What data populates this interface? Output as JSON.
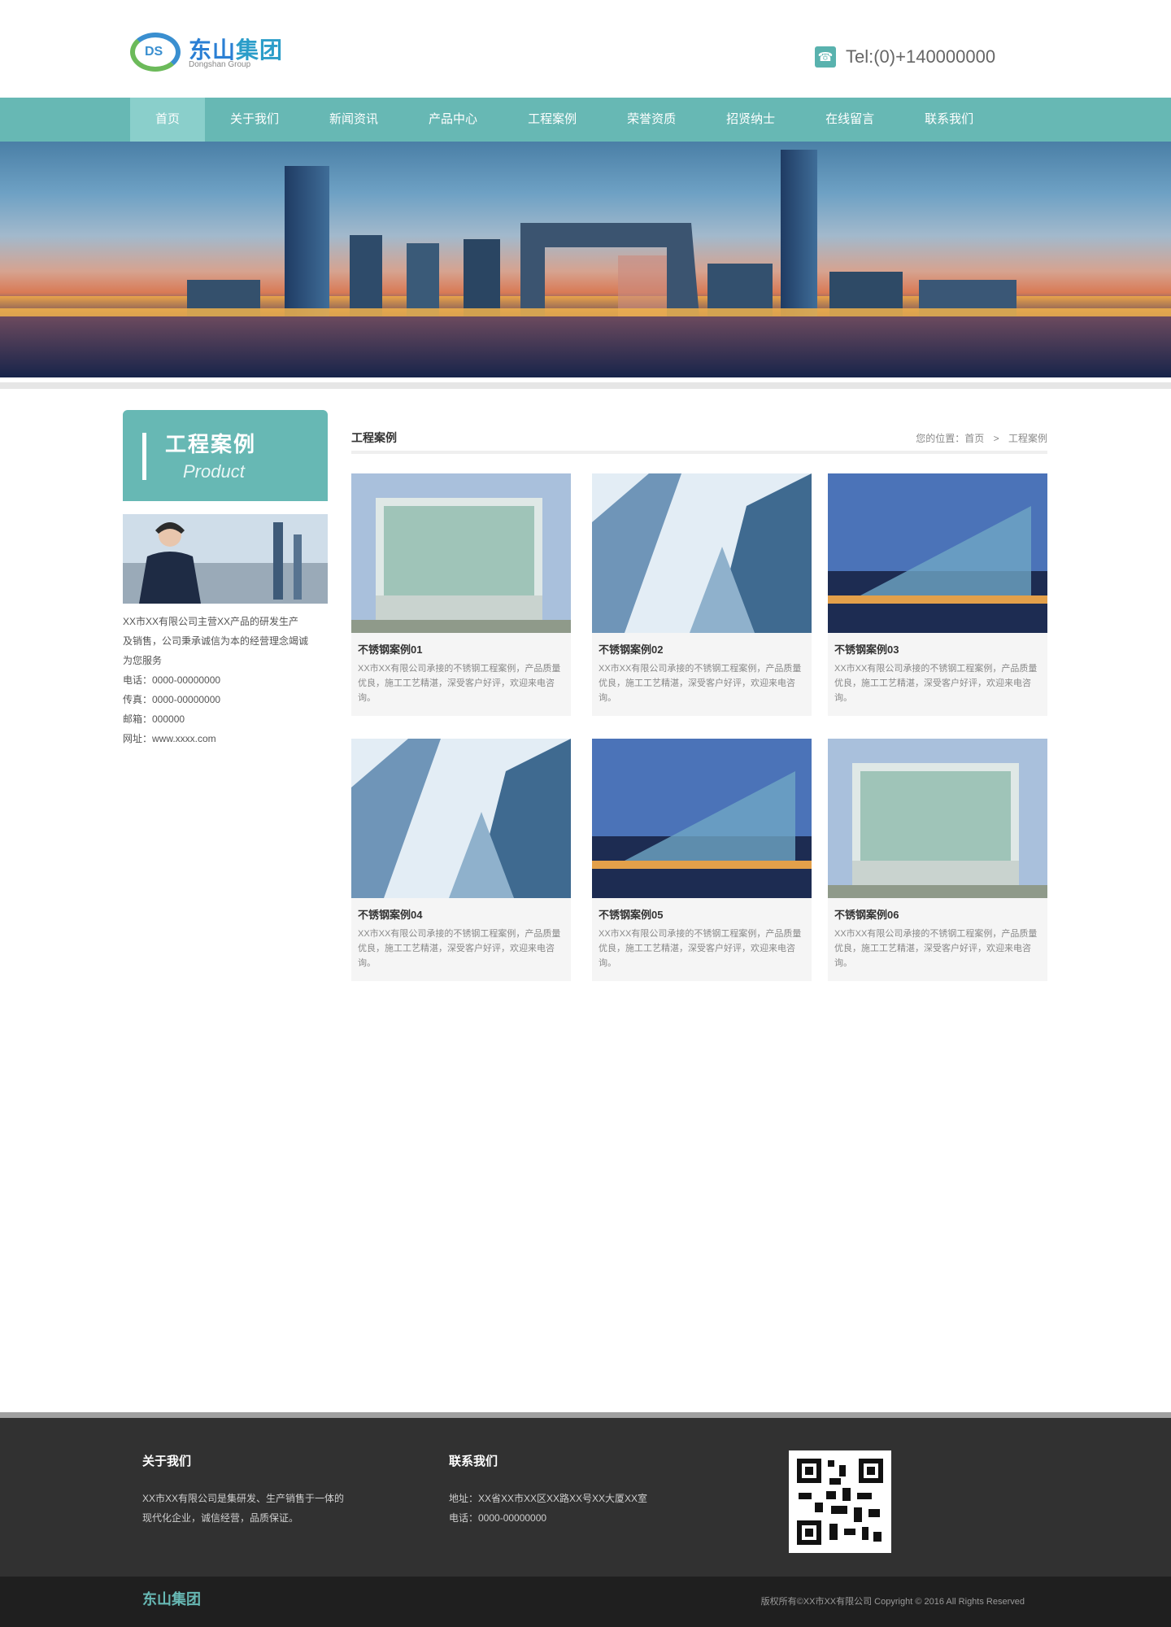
{
  "header": {
    "logo_text_a": "东山",
    "logo_text_b": "集团",
    "logo_sub": "Dongshan Group",
    "phone": "Tel:(0)+140000000"
  },
  "nav": {
    "items": [
      "首页",
      "关于我们",
      "新闻资讯",
      "产品中心",
      "工程案例",
      "荣誉资质",
      "招贤纳士",
      "在线留言",
      "联系我们"
    ],
    "active_index": 0
  },
  "sidebar": {
    "title_cn": "工程案例",
    "title_en": "Product",
    "info_lines": [
      "XX市XX有限公司主营XX产品的研发生产",
      "及销售，公司秉承诚信为本的经营理念竭诚",
      "为您服务",
      "电话：0000-00000000",
      "传真：0000-00000000",
      "邮箱：000000",
      "网址：www.xxxx.com"
    ]
  },
  "main": {
    "title": "工程案例",
    "breadcrumb_home": "您的位置：首页",
    "breadcrumb_current": "工程案例",
    "cards": [
      {
        "title": "不锈钢案例01",
        "desc": "XX市XX有限公司承接的不锈钢工程案例，产品质量优良，施工工艺精湛，深受客户好评，欢迎来电咨询。"
      },
      {
        "title": "不锈钢案例02",
        "desc": "XX市XX有限公司承接的不锈钢工程案例，产品质量优良，施工工艺精湛，深受客户好评，欢迎来电咨询。"
      },
      {
        "title": "不锈钢案例03",
        "desc": "XX市XX有限公司承接的不锈钢工程案例，产品质量优良，施工工艺精湛，深受客户好评，欢迎来电咨询。"
      },
      {
        "title": "不锈钢案例04",
        "desc": "XX市XX有限公司承接的不锈钢工程案例，产品质量优良，施工工艺精湛，深受客户好评，欢迎来电咨询。"
      },
      {
        "title": "不锈钢案例05",
        "desc": "XX市XX有限公司承接的不锈钢工程案例，产品质量优良，施工工艺精湛，深受客户好评，欢迎来电咨询。"
      },
      {
        "title": "不锈钢案例06",
        "desc": "XX市XX有限公司承接的不锈钢工程案例，产品质量优良，施工工艺精湛，深受客户好评，欢迎来电咨询。"
      }
    ]
  },
  "footer": {
    "about_title": "关于我们",
    "about_lines": [
      "XX市XX有限公司是集研发、生产销售于一体的",
      "现代化企业，诚信经营，品质保证。"
    ],
    "contact_title": "联系我们",
    "contact_lines": [
      "地址：XX省XX市XX区XX路XX号XX大厦XX室",
      "电话：0000-00000000"
    ],
    "bottom_logo": "东山集团",
    "copyright": "版权所有©XX市XX有限公司    Copyright © 2016 All Rights Reserved"
  },
  "colors": {
    "accent": "#67b8b4",
    "accent_light": "#8acfcb",
    "footer_bg": "#313131",
    "bottom_bg": "#1f1f1f"
  }
}
